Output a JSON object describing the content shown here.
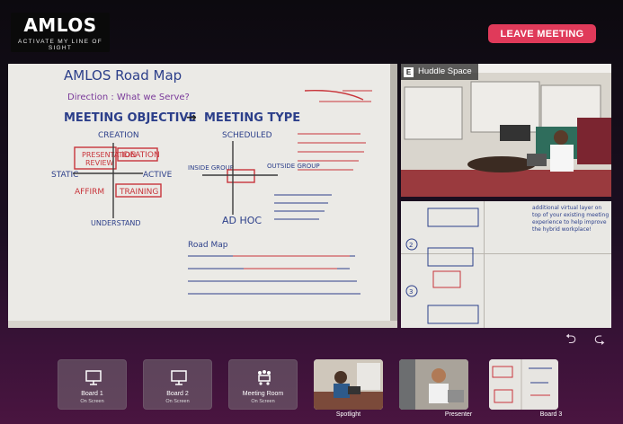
{
  "header": {
    "logo_text": "AMLOS",
    "logo_tagline": "ACTIVATE MY LINE OF SIGHT",
    "leave_label": "LEAVE MEETING"
  },
  "main_feed": {
    "whiteboard": {
      "title": "AMLOS Road Map",
      "direction": "Direction : What we Serve?",
      "objective": "MEETING OBJECTIVE",
      "type": "MEETING TYPE",
      "creation": "CREATION",
      "scheduled": "SCHEDULED",
      "presentation": "PRESENTATION",
      "review": "REVIEW",
      "ideation": "IDEATION",
      "static": "STATIC",
      "active": "ACTIVE",
      "affirm": "AFFIRM",
      "training": "TRAINING",
      "understand": "UNDERSTAND",
      "inside_group": "INSIDE GROUP",
      "outside_group": "OUTSIDE GROUP",
      "ad_hoc": "AD HOC",
      "road_map": "Road Map"
    }
  },
  "side_feed_top": {
    "badge": "E",
    "label": "Huddle Space"
  },
  "side_feed_bottom": {
    "note": "additional virtual layer on top of your existing meeting experience to help improve the hybrid workplace!"
  },
  "nav": {
    "prev_icon": "undo-icon",
    "next_icon": "redo-icon"
  },
  "thumbnails": [
    {
      "title": "Board 1",
      "sub": "On Screen",
      "caption": ""
    },
    {
      "title": "Board 2",
      "sub": "On Screen",
      "caption": ""
    },
    {
      "title": "Meeting Room",
      "sub": "On Screen",
      "caption": ""
    },
    {
      "title": "",
      "sub": "",
      "caption": "Spotlight"
    },
    {
      "title": "",
      "sub": "",
      "caption": "Presenter"
    },
    {
      "title": "",
      "sub": "",
      "caption": "Board 3"
    }
  ],
  "colors": {
    "accent": "#e03a5a",
    "marker_red": "#c8343a",
    "marker_blue": "#2c3f8a"
  }
}
